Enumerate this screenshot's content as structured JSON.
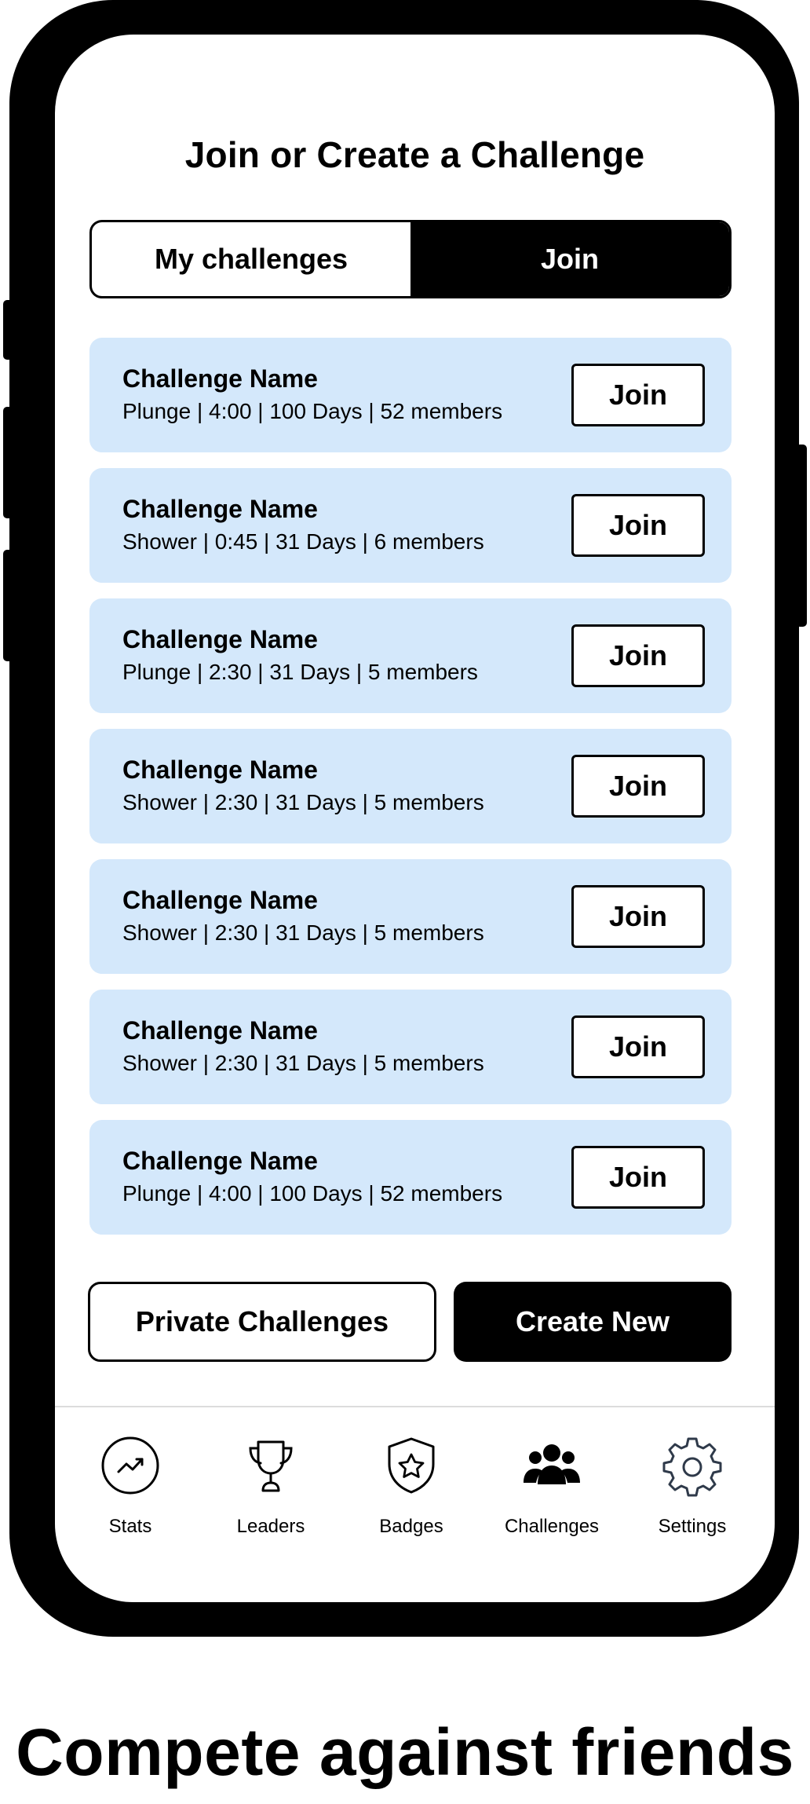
{
  "screen": {
    "title": "Join or Create a Challenge"
  },
  "tabs": [
    {
      "label": "My challenges",
      "active": false
    },
    {
      "label": "Join",
      "active": true
    }
  ],
  "challenges": [
    {
      "name": "Challenge Name",
      "meta": "Plunge | 4:00 | 100 Days | 52 members",
      "button": "Join"
    },
    {
      "name": "Challenge Name",
      "meta": "Shower | 0:45 | 31 Days | 6 members",
      "button": "Join"
    },
    {
      "name": "Challenge Name",
      "meta": "Plunge | 2:30 | 31 Days | 5 members",
      "button": "Join"
    },
    {
      "name": "Challenge Name",
      "meta": "Shower | 2:30 | 31 Days | 5 members",
      "button": "Join"
    },
    {
      "name": "Challenge Name",
      "meta": "Shower | 2:30 | 31 Days | 5 members",
      "button": "Join"
    },
    {
      "name": "Challenge Name",
      "meta": "Shower | 2:30 | 31 Days | 5 members",
      "button": "Join"
    },
    {
      "name": "Challenge Name",
      "meta": "Plunge | 4:00 | 100 Days | 52 members",
      "button": "Join"
    }
  ],
  "actions": {
    "private_label": "Private Challenges",
    "create_label": "Create New"
  },
  "nav": [
    {
      "label": "Stats",
      "icon": "stats-icon"
    },
    {
      "label": "Leaders",
      "icon": "trophy-icon"
    },
    {
      "label": "Badges",
      "icon": "shield-star-icon"
    },
    {
      "label": "Challenges",
      "icon": "group-icon"
    },
    {
      "label": "Settings",
      "icon": "gear-icon"
    }
  ],
  "colors": {
    "card_bg": "#d4e8fb",
    "accent": "#000000",
    "settings_icon": "#2f3a4a"
  },
  "tagline": "Compete against friends"
}
